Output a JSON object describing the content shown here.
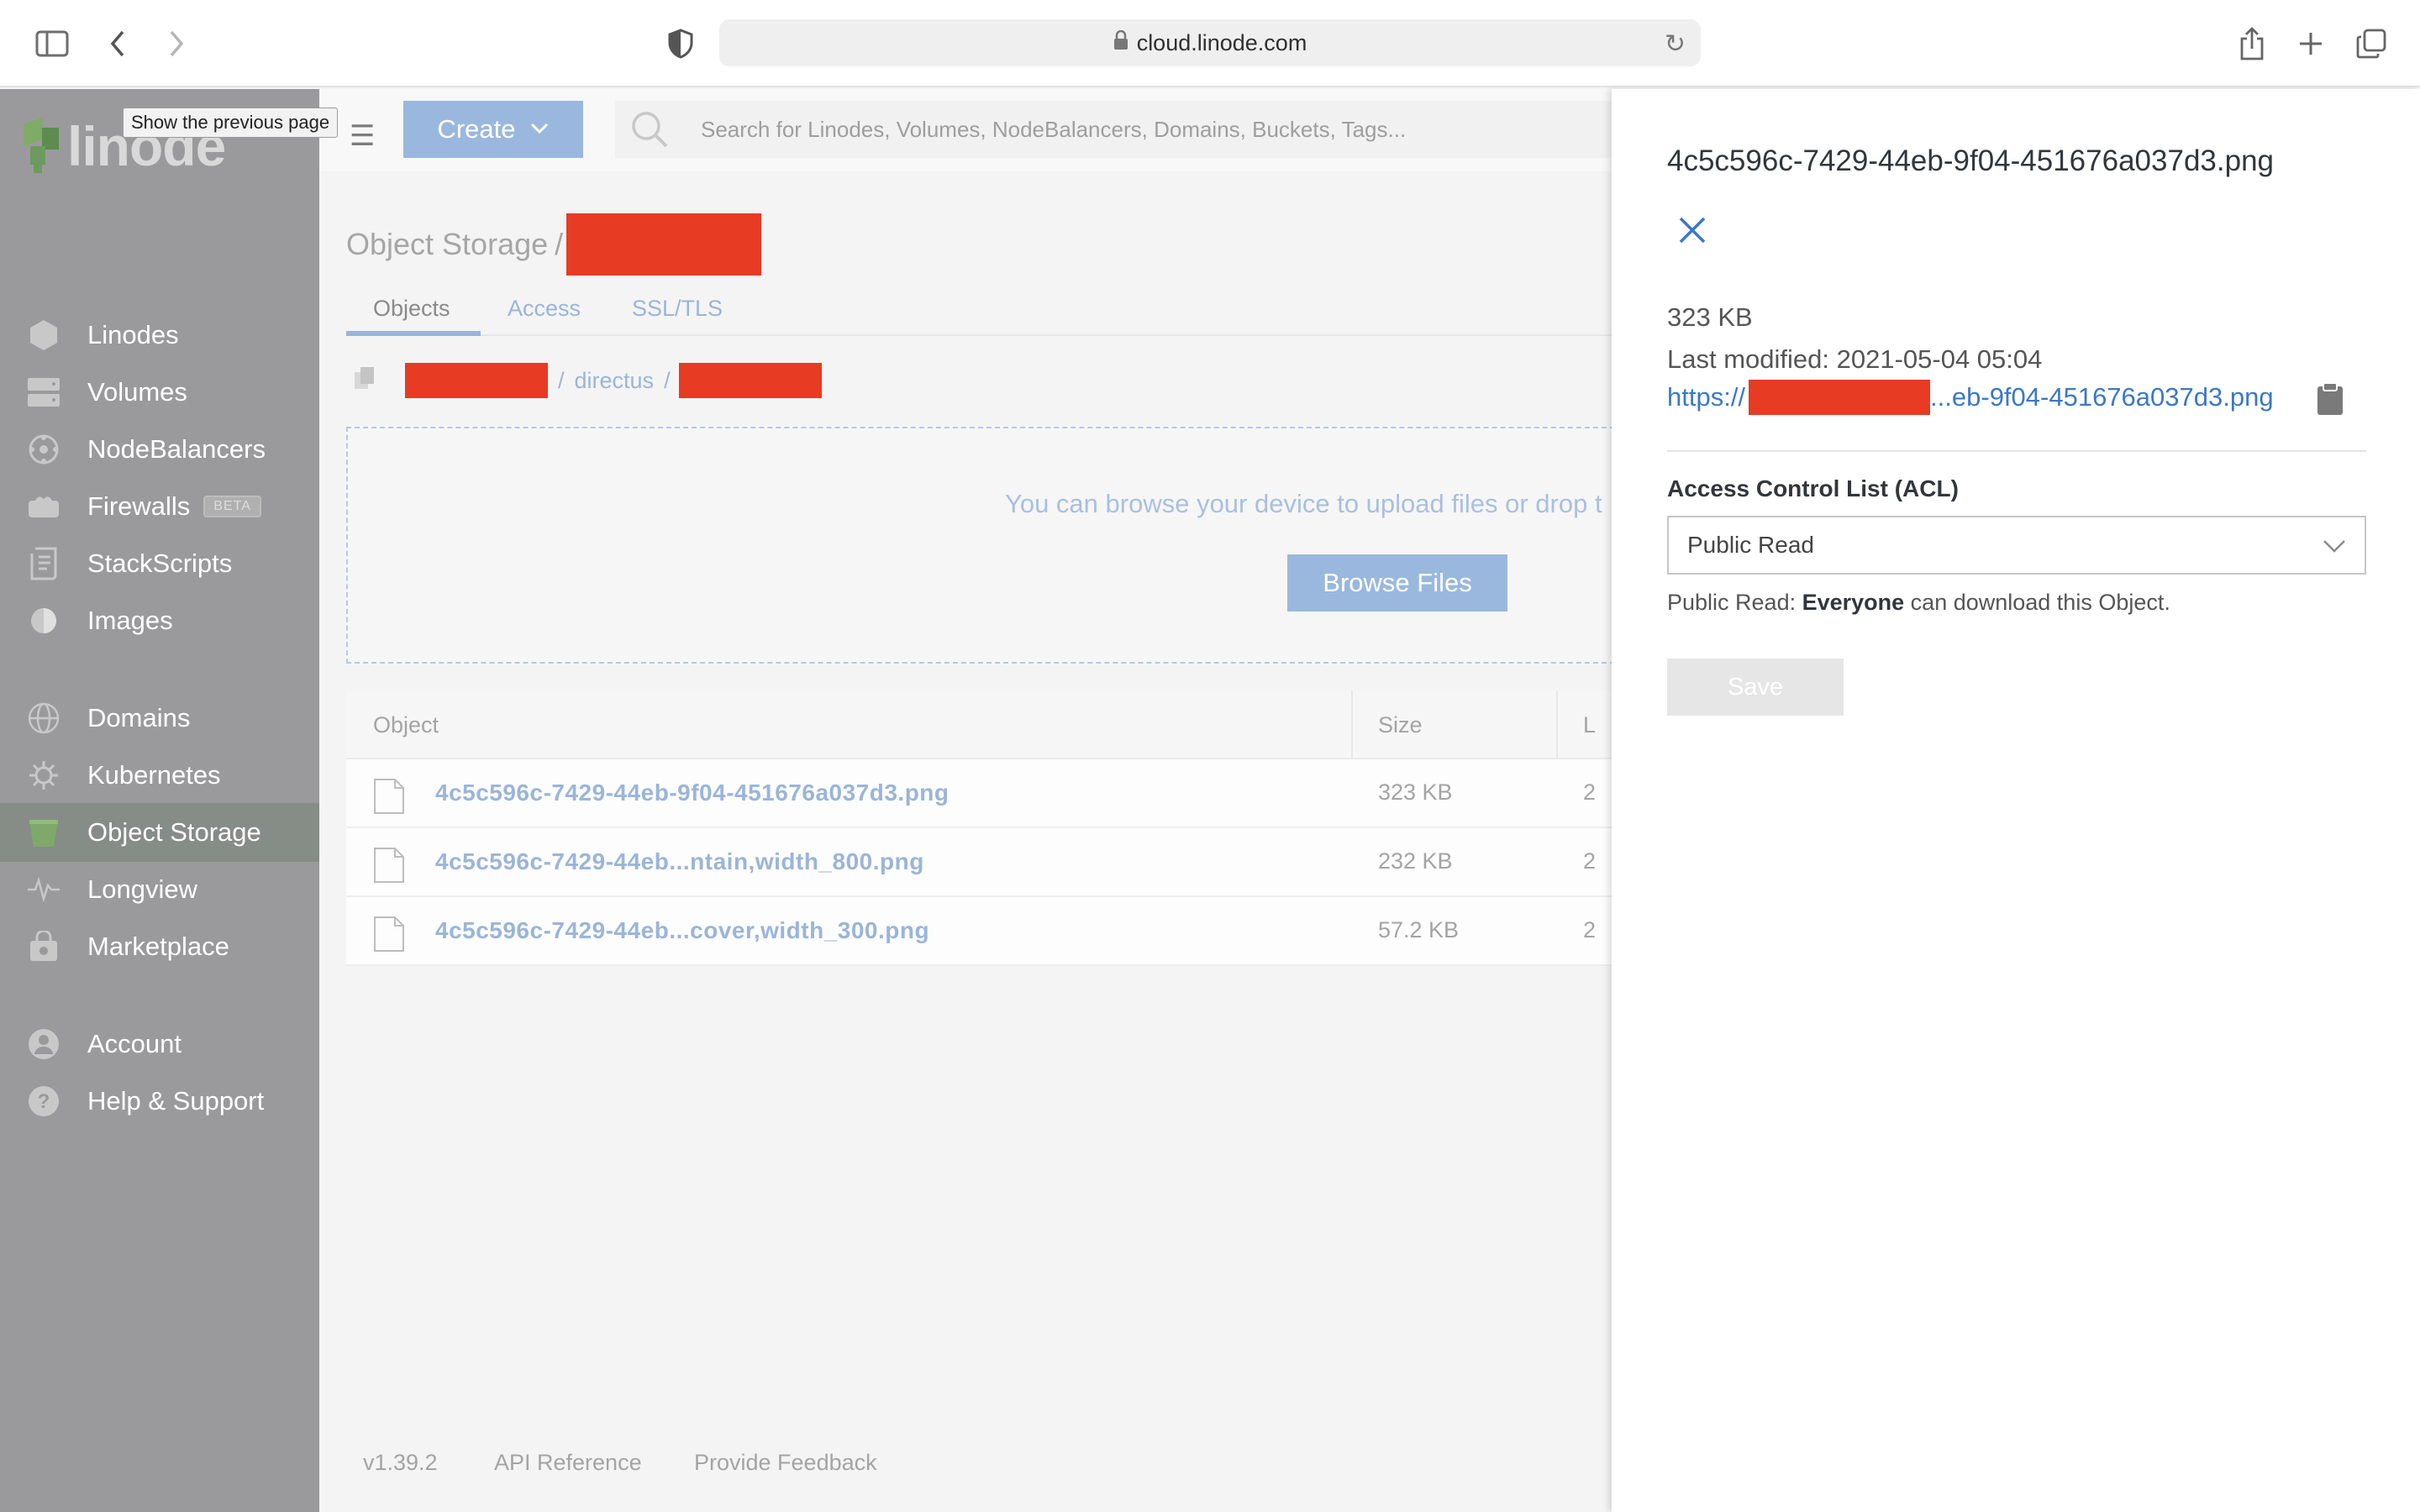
{
  "browser": {
    "url": "cloud.linode.com",
    "sidebar_icon": "sidebar-toggle-icon",
    "back_icon": "chevron-left-icon",
    "forward_icon": "chevron-right-icon",
    "shield_icon": "privacy-shield-icon",
    "share_icon": "share-icon",
    "new_tab_icon": "plus-icon",
    "tabs_icon": "tab-overview-icon"
  },
  "tooltip": "Show the previous page",
  "logo": {
    "text": "linode"
  },
  "sidebar": {
    "items": [
      {
        "label": "Linodes",
        "icon": "hexagon-icon"
      },
      {
        "label": "Volumes",
        "icon": "volume-icon"
      },
      {
        "label": "NodeBalancers",
        "icon": "nodebalancer-icon"
      },
      {
        "label": "Firewalls",
        "icon": "firewall-icon",
        "badge": "BETA"
      },
      {
        "label": "StackScripts",
        "icon": "script-icon"
      },
      {
        "label": "Images",
        "icon": "image-icon"
      },
      {
        "label": "Domains",
        "icon": "globe-icon"
      },
      {
        "label": "Kubernetes",
        "icon": "kubernetes-icon"
      },
      {
        "label": "Object Storage",
        "icon": "bucket-icon",
        "active": true
      },
      {
        "label": "Longview",
        "icon": "pulse-icon"
      },
      {
        "label": "Marketplace",
        "icon": "marketplace-icon"
      },
      {
        "label": "Account",
        "icon": "account-icon"
      },
      {
        "label": "Help & Support",
        "icon": "help-icon"
      }
    ]
  },
  "topbar": {
    "create_label": "Create",
    "search_placeholder": "Search for Linodes, Volumes, NodeBalancers, Domains, Buckets, Tags..."
  },
  "breadcrumb": {
    "root": "Object Storage",
    "separator": "/"
  },
  "tabs": [
    "Objects",
    "Access",
    "SSL/TLS"
  ],
  "path": {
    "folder": "directus",
    "separator": "/"
  },
  "dropzone": {
    "text": "You can browse your device to upload files or drop t",
    "button": "Browse Files"
  },
  "table": {
    "headers": [
      "Object",
      "Size",
      "L"
    ],
    "rows": [
      {
        "name": "4c5c596c-7429-44eb-9f04-451676a037d3.png",
        "size": "323 KB",
        "mod": "2"
      },
      {
        "name": "4c5c596c-7429-44eb...ntain,width_800.png",
        "size": "232 KB",
        "mod": "2"
      },
      {
        "name": "4c5c596c-7429-44eb...cover,width_300.png",
        "size": "57.2 KB",
        "mod": "2"
      }
    ]
  },
  "footer": {
    "version": "v1.39.2",
    "api": "API Reference",
    "feedback": "Provide Feedback"
  },
  "drawer": {
    "title": "4c5c596c-7429-44eb-9f04-451676a037d3.png",
    "size": "323 KB",
    "last_modified": "Last modified: 2021-05-04 05:04",
    "url_prefix": "https://",
    "url_suffix": "...eb-9f04-451676a037d3.png",
    "acl_label": "Access Control List (ACL)",
    "acl_value": "Public Read",
    "help_prefix": "Public Read: ",
    "help_bold": "Everyone",
    "help_suffix": " can download this Object.",
    "save_label": "Save"
  },
  "colors": {
    "accent": "#3b78c6",
    "redaction": "#e73b24",
    "sidebar": "#9a9a9c"
  }
}
